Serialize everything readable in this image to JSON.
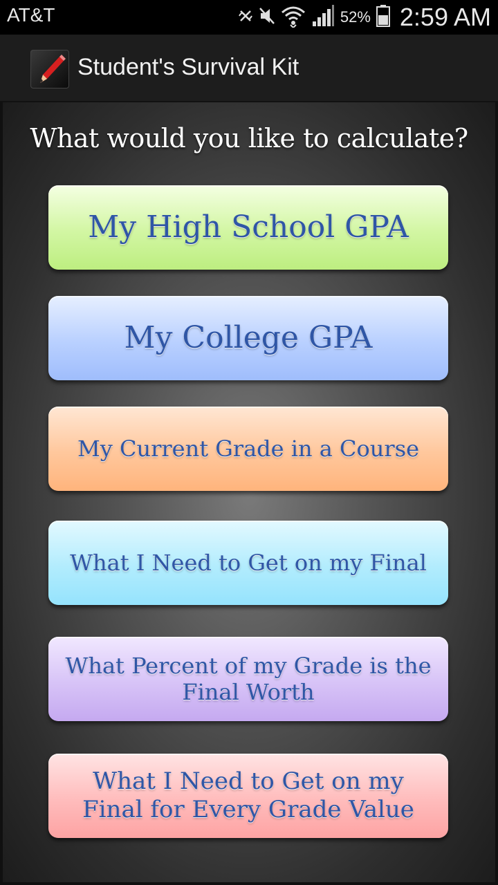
{
  "status_bar": {
    "carrier": "AT&T",
    "battery_percent": "52%",
    "time": "2:59 AM",
    "icons": [
      "nfc-icon",
      "mute-icon",
      "wifi-icon",
      "signal-icon",
      "battery-icon"
    ]
  },
  "action_bar": {
    "app_icon": "pencil-icon",
    "title": "Student's Survival Kit"
  },
  "main": {
    "question": "What would you like to calculate?",
    "options": [
      {
        "label": "My High School GPA",
        "color": "#c8f392"
      },
      {
        "label": "My College GPA",
        "color": "#adc8ff"
      },
      {
        "label": "My Current Grade in a Course",
        "color": "#ffbd8a"
      },
      {
        "label": "What  I Need to Get on my Final",
        "color": "#a3e8fd"
      },
      {
        "label": "What  Percent of my Grade is the Final  Worth",
        "color": "#cfb6f4"
      },
      {
        "label": "What  I Need to Get on my Final  for  Every Grade  Value",
        "color": "#ffb0b0"
      }
    ],
    "text_color": "#2f56a6"
  }
}
